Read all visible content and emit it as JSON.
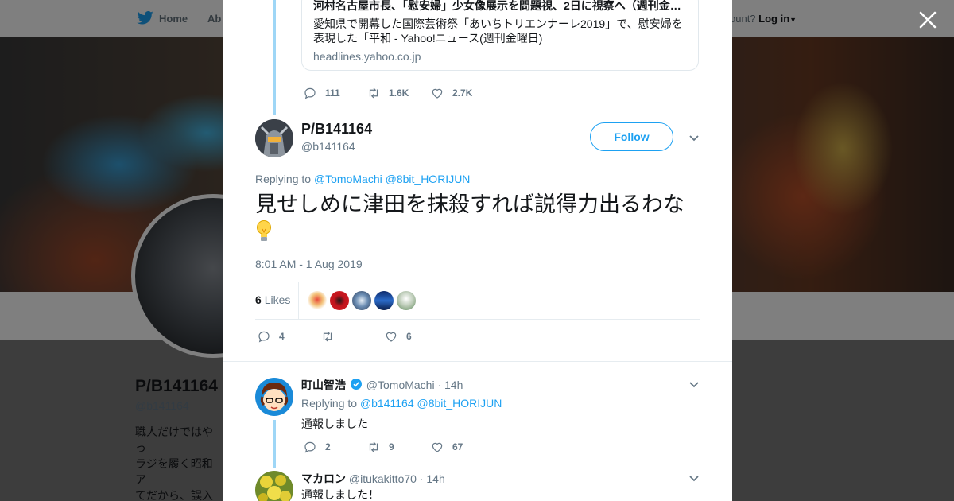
{
  "background": {
    "nav": {
      "home_label": "Home",
      "about_label": "Ab",
      "account_prompt": "ccount?",
      "login_label": "Log in"
    },
    "profile": {
      "name": "P/B141164",
      "handle": "@b141164",
      "bio": "職人だけではやっ\nラジを履く昭和ア\nてだから、誤入力\n手柔らかに。人に\nい、しかし環境や"
    }
  },
  "modal": {
    "quoted_card": {
      "title": "河村名古屋市長、「慰安婦」少女像展示を問題視、2日に視察へ（週刊金…",
      "description": "愛知県で開幕した国際芸術祭「あいちトリエンナーレ2019」で、慰安婦を表現した「平和 - Yahoo!ニュース(週刊金曜日)",
      "domain": "headlines.yahoo.co.jp"
    },
    "parent_actions": {
      "replies": "111",
      "retweets": "1.6K",
      "likes": "2.7K"
    },
    "main_tweet": {
      "name": "P/B141164",
      "handle": "@b141164",
      "follow_label": "Follow",
      "replying_prefix": "Replying to",
      "replying_to": [
        "@TomoMachi",
        "@8bit_HORIJUN"
      ],
      "text": "見せしめに津田を抹殺すれば説得力出るわな",
      "timestamp": "8:01 AM - 1 Aug 2019",
      "likes_count": "6",
      "likes_label": "Likes",
      "actions": {
        "replies": "4",
        "retweets": "",
        "likes": "6"
      }
    },
    "replies": [
      {
        "name": "町山智浩",
        "verified": true,
        "handle": "@TomoMachi",
        "time": "· 14h",
        "replying_prefix": "Replying to",
        "replying_to": [
          "@b141164",
          "@8bit_HORIJUN"
        ],
        "text": "通報しました",
        "actions": {
          "replies": "2",
          "retweets": "9",
          "likes": "67"
        }
      },
      {
        "name": "マカロン",
        "verified": false,
        "handle": "@itukakitto70",
        "time": "· 14h",
        "text": "通報しました！"
      }
    ]
  },
  "icons": [
    "twitter-bird-icon",
    "close-icon",
    "reply-icon",
    "retweet-icon",
    "heart-icon",
    "chevron-down-icon",
    "verified-badge-icon",
    "lightbulb-emoji-icon"
  ],
  "colors": {
    "accent": "#1da1f2",
    "thread_line": "#9ed6f6",
    "muted_text": "#657786"
  }
}
